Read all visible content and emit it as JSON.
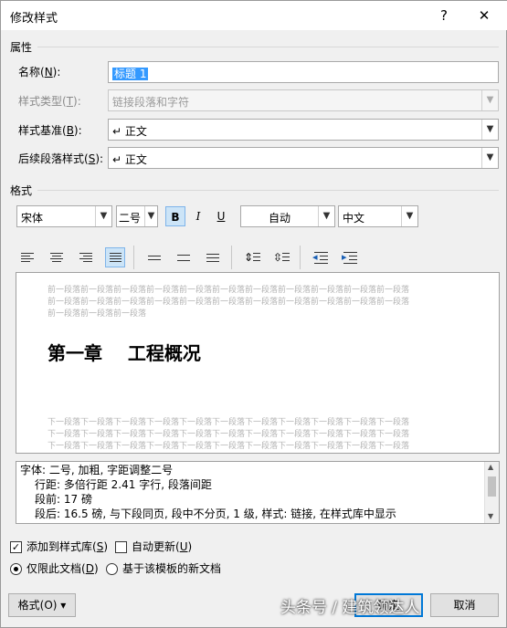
{
  "window": {
    "title": "修改样式",
    "help_icon": "?",
    "close_icon": "✕"
  },
  "properties": {
    "section_label": "属性",
    "name": {
      "label": "名称(",
      "key": "N",
      "suffix": "):",
      "value": "标题 1"
    },
    "style_type": {
      "label": "样式类型(",
      "key": "T",
      "suffix": "):",
      "value": "链接段落和字符"
    },
    "based_on": {
      "label": "样式基准(",
      "key": "B",
      "suffix": "):",
      "value": "↵ 正文"
    },
    "following": {
      "label": "后续段落样式(",
      "key": "S",
      "suffix": "):",
      "value": "↵ 正文"
    }
  },
  "format": {
    "section_label": "格式",
    "font_name": "宋体",
    "font_size": "二号",
    "bold": "B",
    "italic": "I",
    "underline": "U",
    "color": "自动",
    "script": "中文"
  },
  "preview": {
    "prev_line_1": "前一段落前一段落前一段落前一段落前一段落前一段落前一段落前一段落前一段落前一段落前一段落",
    "prev_line_2": "前一段落前一段落前一段落前一段落前一段落前一段落前一段落前一段落前一段落前一段落前一段落",
    "prev_line_3": "前一段落前一段落前一段落",
    "heading": "第一章    工程概况",
    "next_line_1": "下一段落下一段落下一段落下一段落下一段落下一段落下一段落下一段落下一段落下一段落下一段落",
    "next_line_2": "下一段落下一段落下一段落下一段落下一段落下一段落下一段落下一段落下一段落下一段落下一段落",
    "next_line_3": "下一段落下一段落下一段落下一段落下一段落下一段落下一段落下一段落下一段落下一段落下一段落"
  },
  "description": {
    "line_1": "字体: 二号, 加粗, 字距调整二号",
    "line_2": "行距: 多倍行距 2.41 字行, 段落间距",
    "line_3": "段前: 17 磅",
    "line_4": "段后: 16.5 磅, 与下段同页, 段中不分页, 1 级, 样式: 链接, 在样式库中显示"
  },
  "options": {
    "add_to_gallery": {
      "label": "添加到样式库(",
      "key": "S",
      "suffix": ")",
      "checked": true
    },
    "auto_update": {
      "label": "自动更新(",
      "key": "U",
      "suffix": ")",
      "checked": false
    },
    "only_this_doc": {
      "label": "仅限此文档(",
      "key": "D",
      "suffix": ")",
      "selected": true
    },
    "new_docs_template": {
      "label": "基于该模板的新文档",
      "selected": false
    }
  },
  "buttons": {
    "format": "格式(O) ▾",
    "ok": "确定",
    "cancel": "取消"
  },
  "watermark": "头条号 / 建筑领达人"
}
